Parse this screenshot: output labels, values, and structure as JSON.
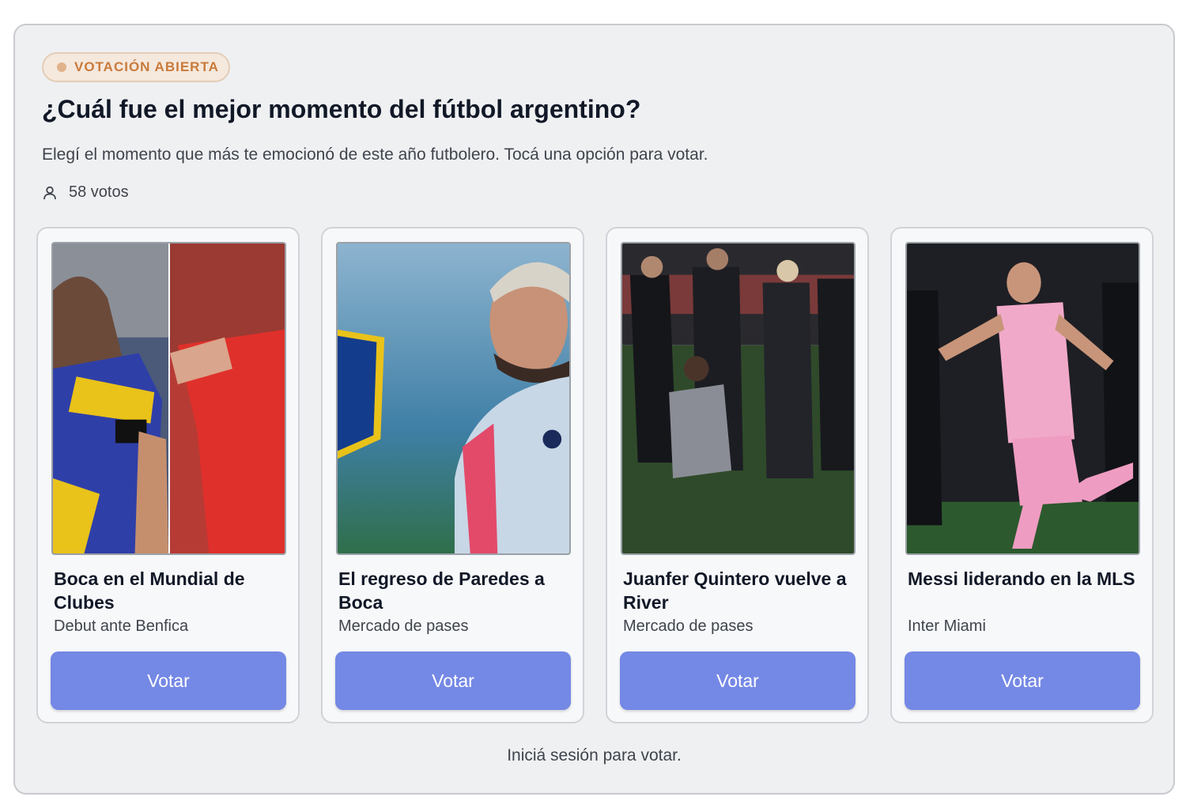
{
  "poll": {
    "badge": "VOTACIÓN ABIERTA",
    "title": "¿Cuál fue el mejor momento del fútbol argentino?",
    "subtitle": "Elegí el momento que más te emocionó de este año futbolero. Tocá una opción para votar.",
    "votes_label": "58 votos",
    "login_note": "Iniciá sesión para votar."
  },
  "options": [
    {
      "title": "Boca en el Mundial de Clubes",
      "subtitle": "Debut ante Benfica",
      "button": "Votar",
      "image": "boca-vs-benfica-photo"
    },
    {
      "title": "El regreso de Paredes a Boca",
      "subtitle": "Mercado de pases",
      "button": "Votar",
      "image": "paredes-photo"
    },
    {
      "title": "Juanfer Quintero vuelve a River",
      "subtitle": "Mercado de pases",
      "button": "Votar",
      "image": "quintero-photo"
    },
    {
      "title": "Messi liderando en la MLS",
      "subtitle": "Inter Miami",
      "button": "Votar",
      "image": "messi-photo"
    }
  ],
  "colors": {
    "accent": "#7488e5",
    "badge_bg": "#f5e8dd",
    "badge_text": "#c97a3a",
    "card_bg": "#eff0f2"
  },
  "icons": {
    "votes": "user-icon"
  }
}
